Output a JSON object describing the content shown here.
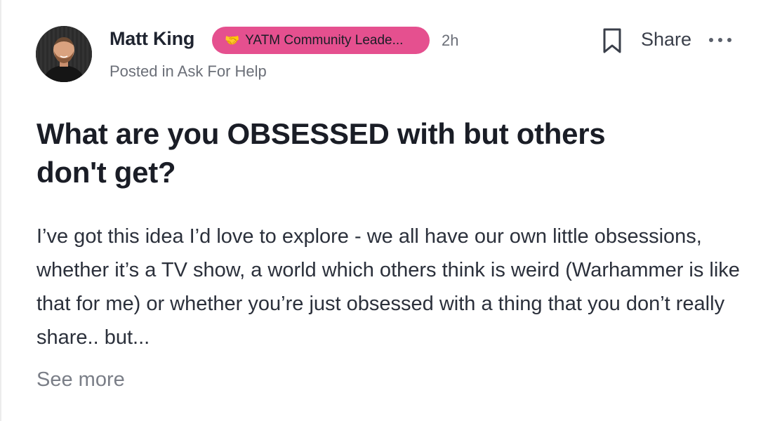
{
  "post": {
    "author": {
      "name": "Matt King",
      "badge_label": "YATM Community Leade...",
      "badge_icon": "handshake-icon",
      "badge_color": "#e5508f"
    },
    "time_ago": "2h",
    "posted_in_prefix": "Posted in",
    "category": "Ask For Help",
    "title": "What are you OBSESSED with but others don't get?",
    "body": "I’ve got this idea I’d love to explore - we all have our own little obsessions, whether it’s a TV show, a world which others think is weird (Warhammer is like that for me) or whether you’re just obsessed with a thing that you don’t really share.. but...",
    "see_more_label": "See more"
  },
  "actions": {
    "bookmark_icon": "bookmark-icon",
    "share_label": "Share",
    "more_icon": "more-options-icon"
  }
}
